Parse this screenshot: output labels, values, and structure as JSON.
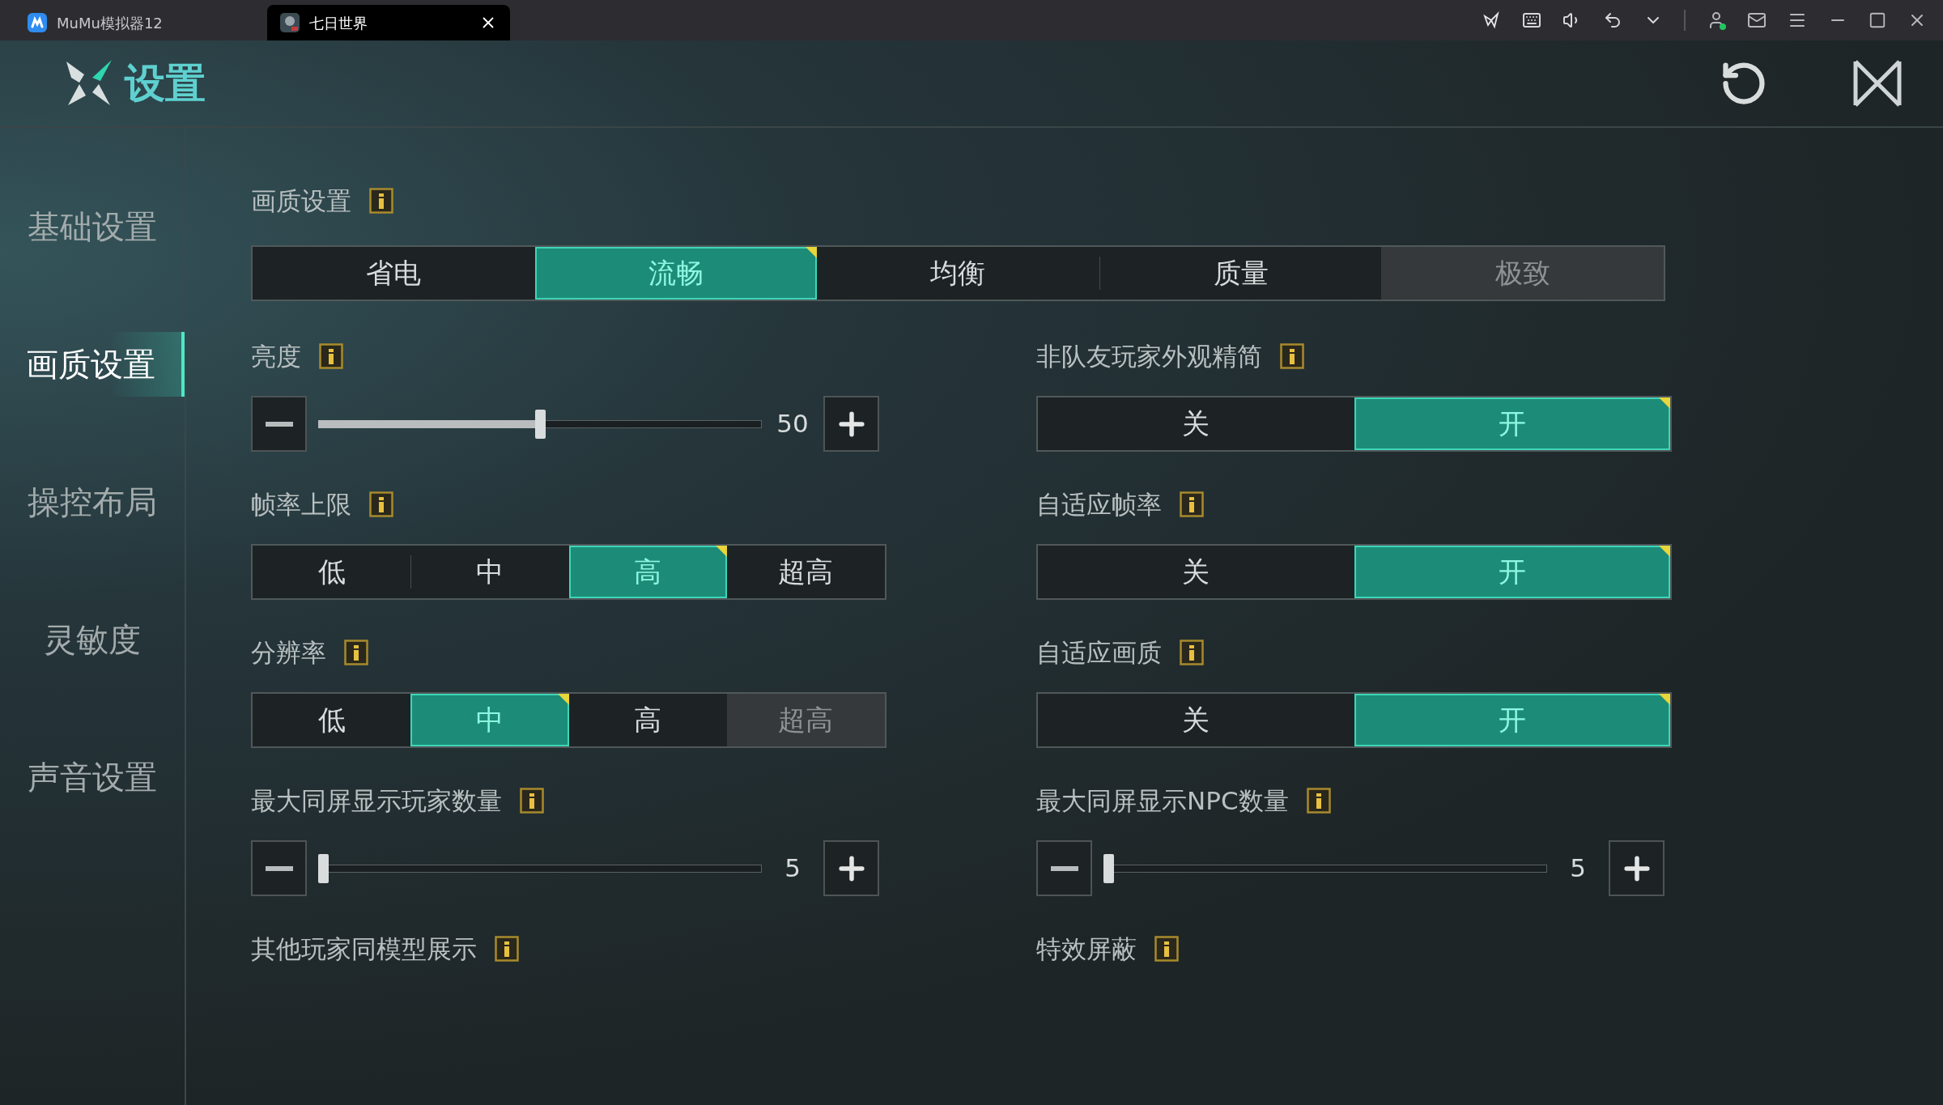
{
  "titlebar": {
    "tabs": [
      {
        "label": "MuMu模拟器12",
        "selected": false
      },
      {
        "label": "七日世界",
        "selected": true
      }
    ]
  },
  "header": {
    "title": "设置"
  },
  "sidebar": {
    "items": [
      {
        "label": "基础设置",
        "selected": false
      },
      {
        "label": "画质设置",
        "selected": true
      },
      {
        "label": "操控布局",
        "selected": false
      },
      {
        "label": "灵敏度",
        "selected": false
      },
      {
        "label": "声音设置",
        "selected": false
      }
    ]
  },
  "quality": {
    "label": "画质设置",
    "options": [
      {
        "label": "省电",
        "selected": false,
        "disabled": false
      },
      {
        "label": "流畅",
        "selected": true,
        "disabled": false
      },
      {
        "label": "均衡",
        "selected": false,
        "disabled": false
      },
      {
        "label": "质量",
        "selected": false,
        "disabled": false
      },
      {
        "label": "极致",
        "selected": false,
        "disabled": true
      }
    ]
  },
  "settings": [
    {
      "kind": "slider",
      "label": "亮度",
      "level": 0.5,
      "reading": "50"
    },
    {
      "kind": "segmented",
      "label": "非队友玩家外观精简",
      "options": [
        {
          "label": "关",
          "selected": false,
          "disabled": false
        },
        {
          "label": "开",
          "selected": true,
          "disabled": false
        }
      ]
    },
    {
      "kind": "segmented",
      "label": "帧率上限",
      "options": [
        {
          "label": "低",
          "selected": false,
          "disabled": false
        },
        {
          "label": "中",
          "selected": false,
          "disabled": false
        },
        {
          "label": "高",
          "selected": true,
          "disabled": false
        },
        {
          "label": "超高",
          "selected": false,
          "disabled": false
        }
      ]
    },
    {
      "kind": "segmented",
      "label": "自适应帧率",
      "options": [
        {
          "label": "关",
          "selected": false,
          "disabled": false
        },
        {
          "label": "开",
          "selected": true,
          "disabled": false
        }
      ]
    },
    {
      "kind": "segmented",
      "label": "分辨率",
      "options": [
        {
          "label": "低",
          "selected": false,
          "disabled": false
        },
        {
          "label": "中",
          "selected": true,
          "disabled": false
        },
        {
          "label": "高",
          "selected": false,
          "disabled": false
        },
        {
          "label": "超高",
          "selected": false,
          "disabled": true
        }
      ]
    },
    {
      "kind": "segmented",
      "label": "自适应画质",
      "options": [
        {
          "label": "关",
          "selected": false,
          "disabled": false
        },
        {
          "label": "开",
          "selected": true,
          "disabled": false
        }
      ]
    },
    {
      "kind": "slider",
      "label": "最大同屏显示玩家数量",
      "level": 0,
      "reading": "5"
    },
    {
      "kind": "slider",
      "label": "最大同屏显示NPC数量",
      "level": 0,
      "reading": "5"
    },
    {
      "kind": "label",
      "label": "其他玩家同模型展示"
    },
    {
      "kind": "label",
      "label": "特效屏蔽"
    }
  ]
}
